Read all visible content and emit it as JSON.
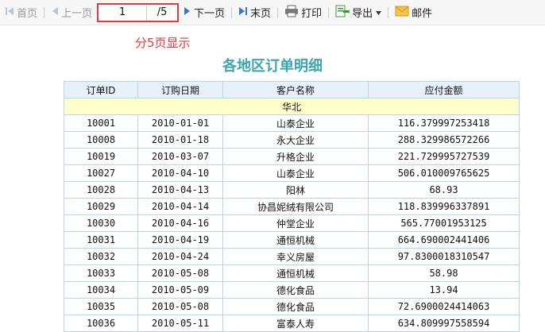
{
  "toolbar": {
    "first_label": "首页",
    "prev_label": "上一页",
    "page_value": "1",
    "total_label": "/5",
    "next_label": "下一页",
    "last_label": "末页",
    "print_label": "打印",
    "export_label": "导出",
    "mail_label": "邮件"
  },
  "annotation": "分5页显示",
  "report": {
    "title": "各地区订单明细",
    "columns": [
      "订单ID",
      "订购日期",
      "客户名称",
      "应付金额"
    ],
    "group": "华北",
    "rows": [
      [
        "10001",
        "2010-01-01",
        "山泰企业",
        "116.379997253418"
      ],
      [
        "10008",
        "2010-01-18",
        "永大企业",
        "288.329986572266"
      ],
      [
        "10019",
        "2010-03-07",
        "升格企业",
        "221.729995727539"
      ],
      [
        "10027",
        "2010-04-10",
        "山泰企业",
        "506.010009765625"
      ],
      [
        "10028",
        "2010-04-13",
        "阳林",
        "68.93"
      ],
      [
        "10029",
        "2010-04-14",
        "协昌妮绒有限公司",
        "118.839996337891"
      ],
      [
        "10030",
        "2010-04-16",
        "仲堂企业",
        "565.77001953125"
      ],
      [
        "10031",
        "2010-04-19",
        "通恒机械",
        "664.690002441406"
      ],
      [
        "10032",
        "2010-04-24",
        "幸义房屋",
        "97.8300018310547"
      ],
      [
        "10033",
        "2010-05-08",
        "通恒机械",
        "58.98"
      ],
      [
        "10034",
        "2010-05-09",
        "德化食品",
        "13.94"
      ],
      [
        "10035",
        "2010-05-08",
        "德化食品",
        "72.6900024414063"
      ],
      [
        "10036",
        "2010-05-11",
        "富泰人寿",
        "634.809997558594"
      ]
    ]
  }
}
